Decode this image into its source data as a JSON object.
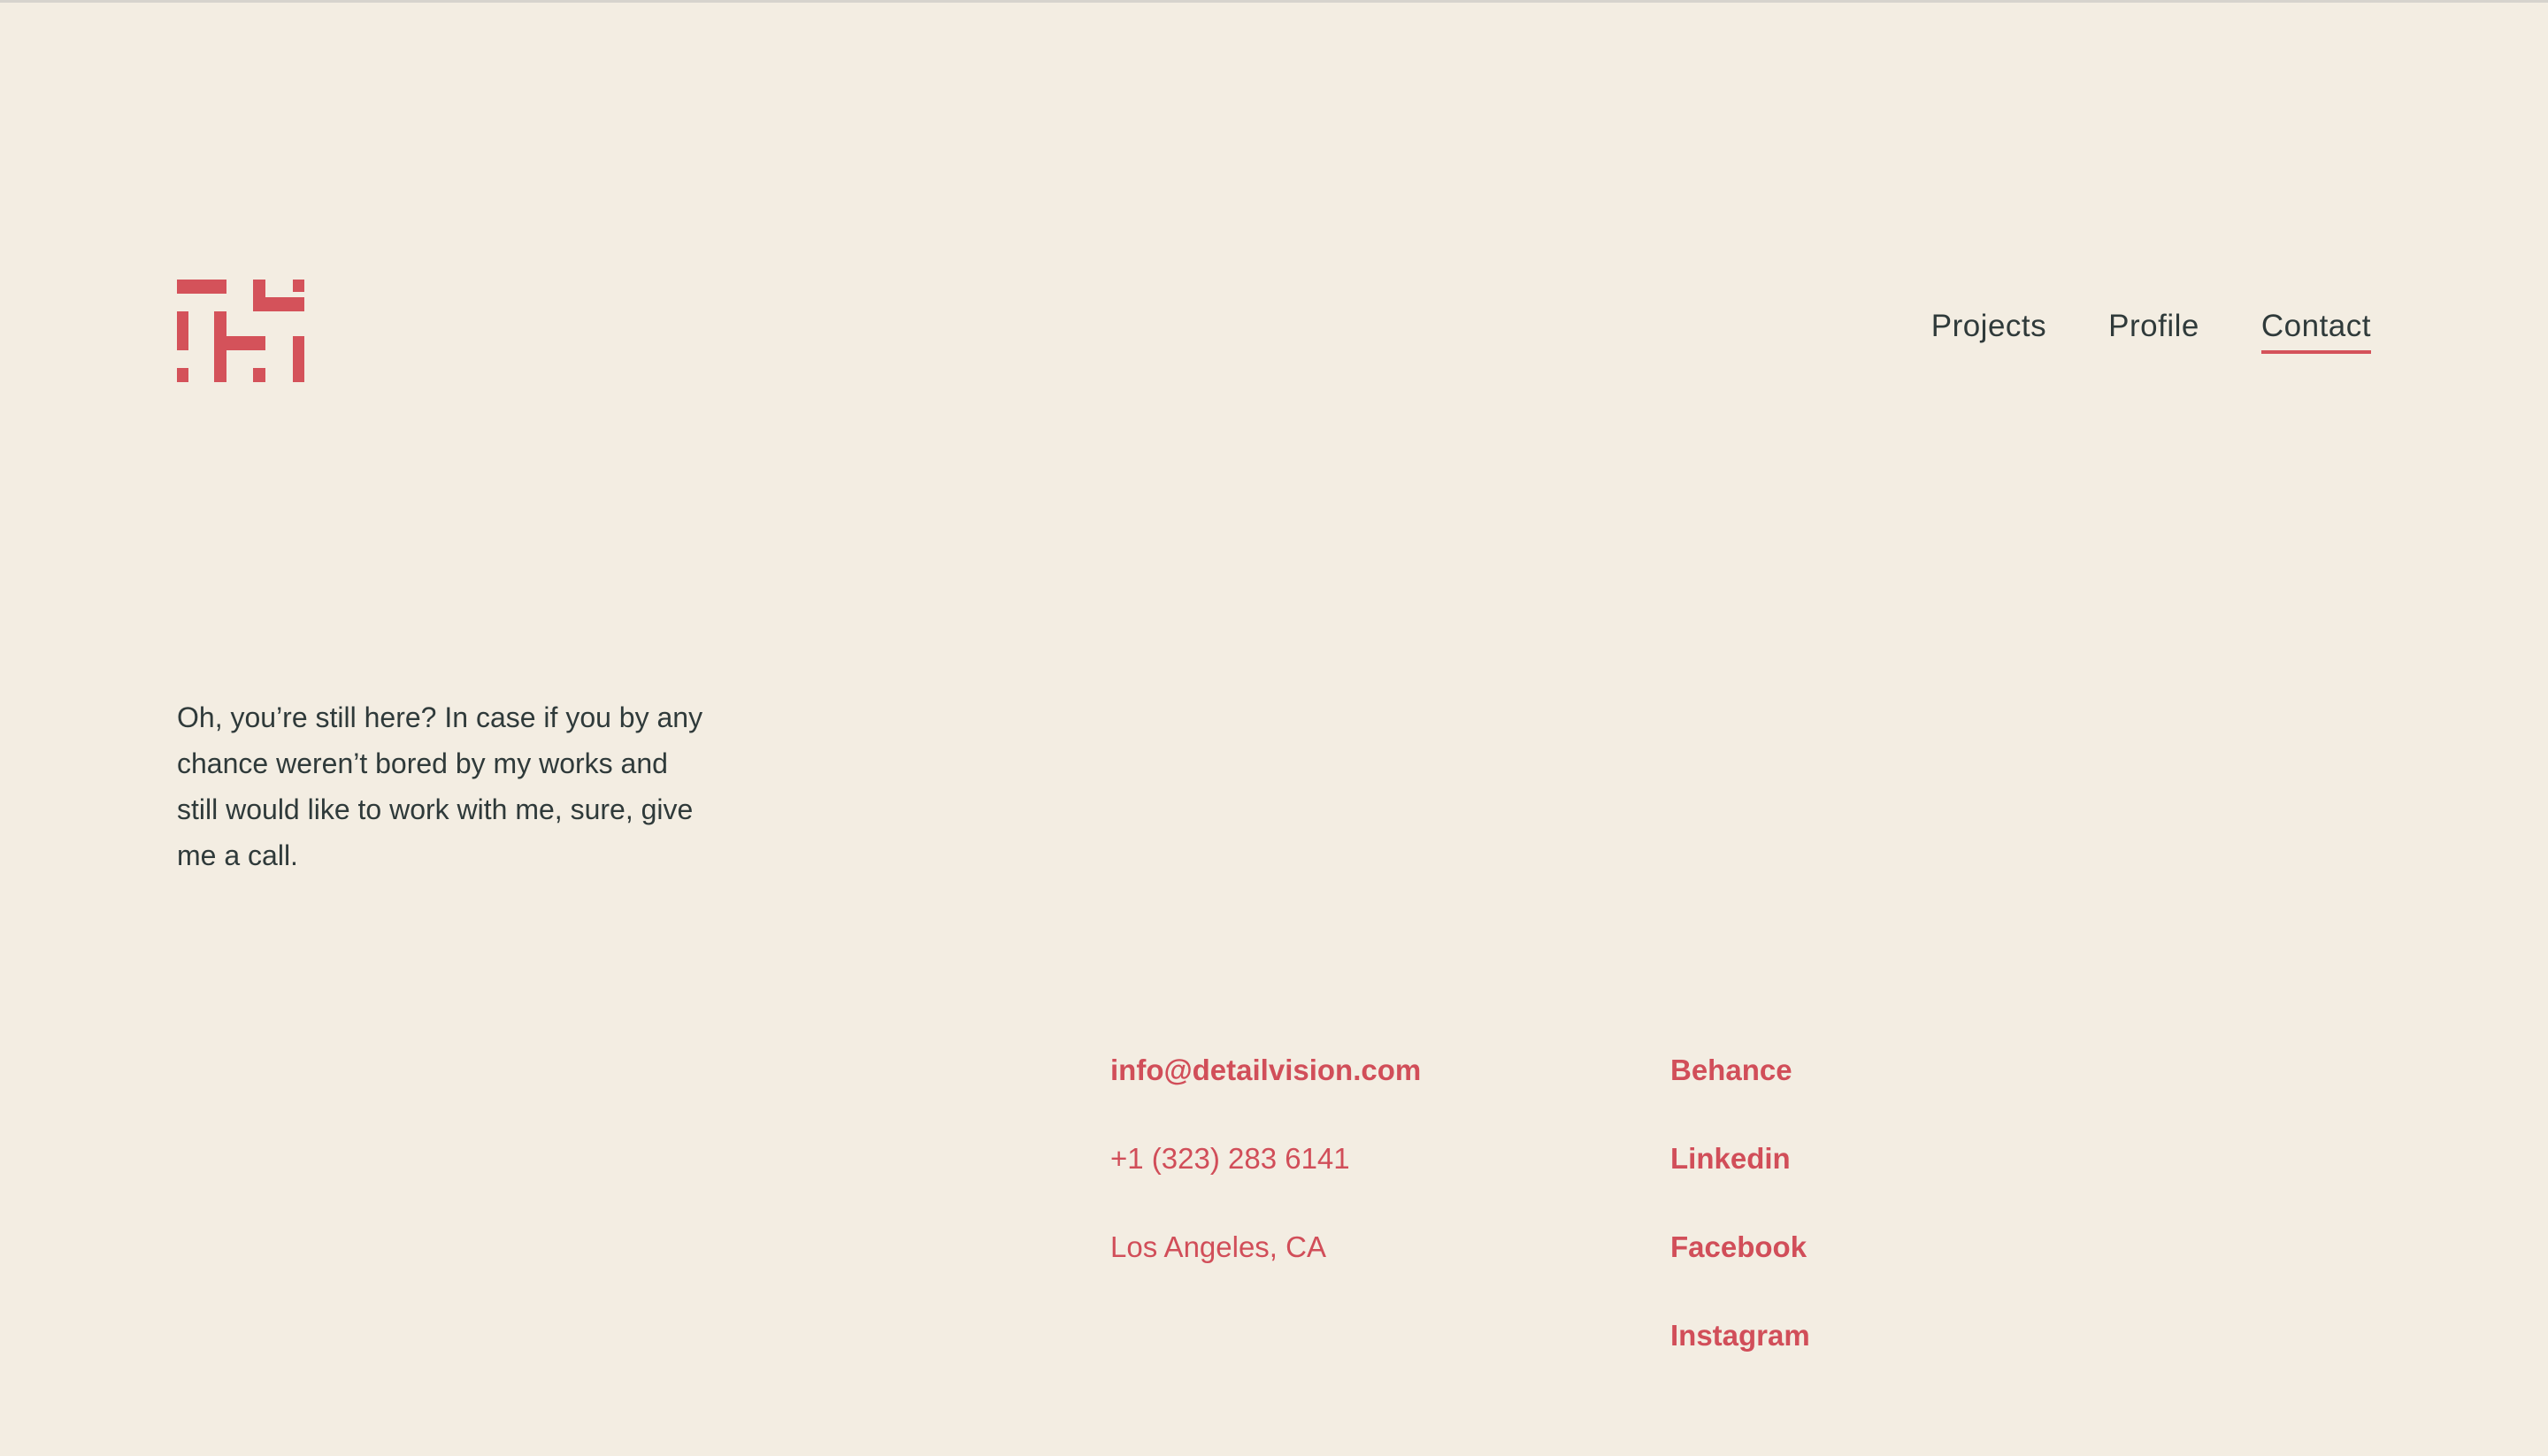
{
  "theme": {
    "background": "#f3ede2",
    "text": "#2f3a3a",
    "accent": "#d4525a"
  },
  "header": {
    "logo_icon": "monogram-logo",
    "nav": [
      {
        "label": "Projects",
        "active": false
      },
      {
        "label": "Profile",
        "active": false
      },
      {
        "label": "Contact",
        "active": true
      }
    ]
  },
  "intro": {
    "text": "Oh, you’re still here? In case if you by any chance weren’t bored by my works and still would like to work with me, sure, give me a call."
  },
  "contact": {
    "email": "info@detailvision.com",
    "phone": "+1 (323) 283 6141",
    "location": "Los Angeles, CA"
  },
  "social": [
    {
      "label": "Behance"
    },
    {
      "label": "Linkedin"
    },
    {
      "label": "Facebook"
    },
    {
      "label": "Instagram"
    }
  ]
}
